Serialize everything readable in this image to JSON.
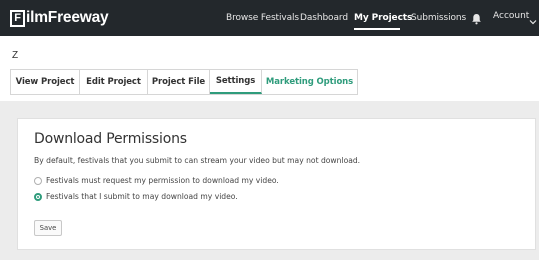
{
  "header": {
    "logo_letter": "F",
    "logo_text": "ilmFreeway",
    "nav": [
      {
        "label": "Browse Festivals"
      },
      {
        "label": "Dashboard"
      },
      {
        "label": "My Projects",
        "active": true
      },
      {
        "label": "Submissions"
      }
    ],
    "account_label": "Account"
  },
  "project": {
    "name": "Z",
    "tabs": [
      {
        "label": "View Project"
      },
      {
        "label": "Edit Project"
      },
      {
        "label": "Project File"
      },
      {
        "label": "Settings",
        "active": true
      },
      {
        "label": "Marketing Options"
      }
    ]
  },
  "download_permissions": {
    "title": "Download Permissions",
    "description": "By default, festivals that you submit to can stream your video but may not download.",
    "options": [
      {
        "label": "Festivals must request my permission to download my video.",
        "checked": false
      },
      {
        "label": "Festivals that I submit to may download my video.",
        "checked": true
      }
    ],
    "save_label": "Save"
  },
  "colors": {
    "topbar": "#23282c",
    "accent_green": "#2f9c7c",
    "content_bg": "#ececec"
  }
}
